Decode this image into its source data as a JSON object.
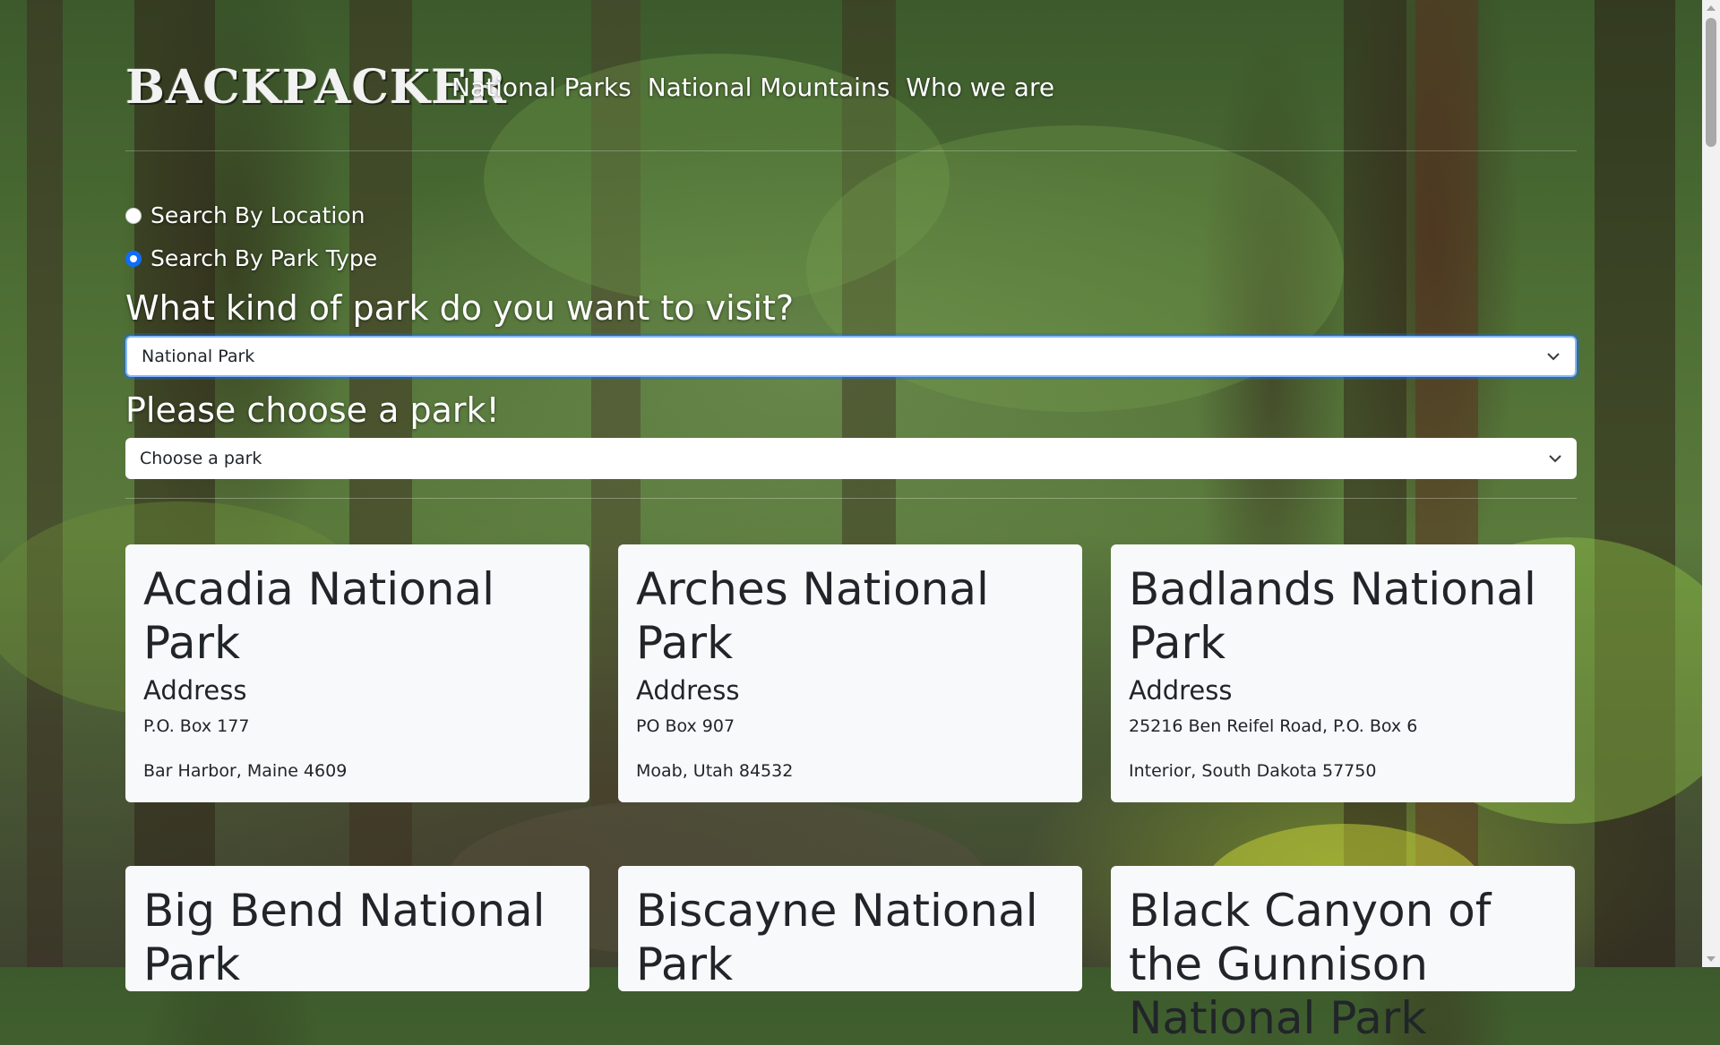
{
  "nav": {
    "brand": "BACKPACKER",
    "links": [
      "National Parks",
      "National Mountains",
      "Who we are"
    ]
  },
  "search": {
    "options": [
      {
        "label": "Search By Location",
        "checked": false
      },
      {
        "label": "Search By Park Type",
        "checked": true
      }
    ],
    "park_type_question": "What kind of park do you want to visit?",
    "park_type_value": "National Park",
    "park_question": "Please choose a park!",
    "park_value": "Choose a park"
  },
  "cards": [
    {
      "name": "Acadia National Park",
      "address_heading": "Address",
      "line1": "P.O. Box 177",
      "line2": "Bar Harbor, Maine 4609"
    },
    {
      "name": "Arches National Park",
      "address_heading": "Address",
      "line1": "PO Box 907",
      "line2": "Moab, Utah 84532"
    },
    {
      "name": "Badlands National Park",
      "address_heading": "Address",
      "line1": "25216 Ben Reifel Road, P.O. Box 6",
      "line2": "Interior, South Dakota 57750"
    },
    {
      "name": "Big Bend National Park"
    },
    {
      "name": "Biscayne National Park"
    },
    {
      "name": "Black Canyon of the Gunnison National Park"
    }
  ],
  "colors": {
    "accent": "#0d6efd",
    "card_bg": "#f8f9fa"
  }
}
